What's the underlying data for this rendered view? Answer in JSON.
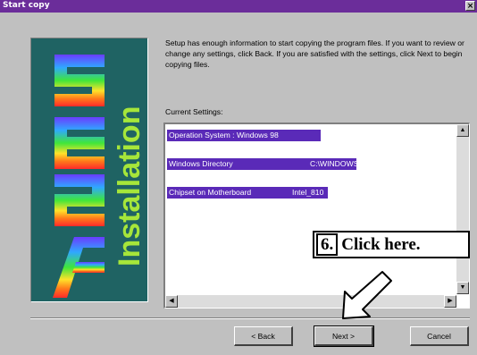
{
  "window": {
    "title": "Start copy",
    "close_glyph": "×"
  },
  "banner": {
    "logo": "/SUS",
    "vertical_text": "Installation",
    "text_color": "#a6e63a",
    "bg_color": "#1f6363"
  },
  "intro_text": "Setup has enough information to start copying the program files. If you want to review or change any settings, click Back.  If you are satisfied with the settings, click Next to begin copying files.",
  "settings": {
    "label": "Current Settings:",
    "rows": [
      {
        "key": "Operation System :  Windows 98",
        "value": ""
      },
      {
        "key": "Windows Directory",
        "value": "C:\\WINDOWS"
      },
      {
        "key": "Chipset on Motherboard",
        "value": "Intel_810"
      }
    ]
  },
  "buttons": {
    "back": "< Back",
    "next": "Next >",
    "cancel": "Cancel"
  },
  "callout": {
    "number": "6.",
    "text": "Click here."
  },
  "colors": {
    "title_bar": "#6b2d9a",
    "selection": "#5a2ab8"
  }
}
